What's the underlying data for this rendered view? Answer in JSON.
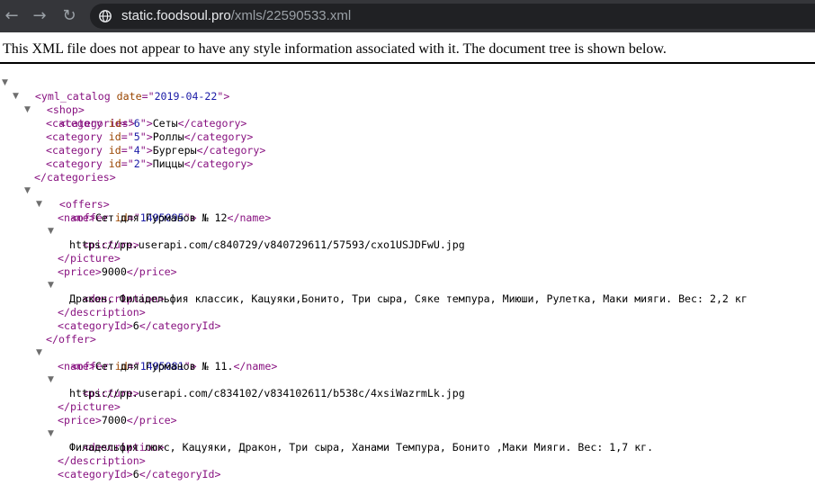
{
  "browser": {
    "url_host": "static.foodsoul.pro",
    "url_path": "/xmls/22590533.xml",
    "back_icon": "←",
    "forward_icon": "→",
    "reload_icon": "↻"
  },
  "viewer": {
    "notice": "This XML file does not appear to have any style information associated with it. The document tree is shown below."
  },
  "xml": {
    "root_open": "<yml_catalog",
    "root_date_attr": " date",
    "root_date_eq": "=\"",
    "root_date": "2019-04-22",
    "root_close": "\">",
    "shop_open": "<shop>",
    "categories_open": "<categories>",
    "categories_close": "</categories>",
    "category_open": "<category",
    "category_close": "</category>",
    "id_attr": " id",
    "eq_quote": "=\"",
    "quote_gt": "\">",
    "categories": [
      {
        "id": "6",
        "name": "Сеты"
      },
      {
        "id": "5",
        "name": "Роллы"
      },
      {
        "id": "4",
        "name": "Бургеры"
      },
      {
        "id": "2",
        "name": "Пиццы"
      }
    ],
    "offers_open": "<offers>",
    "offer_open": "<offer",
    "offer_close": "</offer>",
    "name_open": "<name>",
    "name_close": "</name>",
    "picture_open": "<picture>",
    "picture_close": "</picture>",
    "price_open": "<price>",
    "price_close": "</price>",
    "description_open": "<description>",
    "description_close": "</description>",
    "categoryid_open": "<categoryId>",
    "categoryid_close": "</categoryId>",
    "offers": [
      {
        "id": "1495095",
        "name": "Сет для Гурманов № 12",
        "picture": "https://pp.userapi.com/c840729/v840729611/57593/cxo1USJDFwU.jpg",
        "price": "9000",
        "description": "Дракон, Филадельфия классик, Кацуяки,Бонито, Три сыра, Сяке темпура, Миюши, Рулетка, Маки мияги. Вес: 2,2 кг",
        "categoryId": "6"
      },
      {
        "id": "1495081",
        "name": "Сет для Гурманов № 11.",
        "picture": "https://pp.userapi.com/c834102/v834102611/b538c/4xsiWazrmLk.jpg",
        "price": "7000",
        "description": "Филадельфия люкс, Кацуяки, Дракон, Три сыра, Ханами Темпура, Бонито ,Маки Мияги. Вес: 1,7 кг.",
        "categoryId": "6"
      }
    ]
  }
}
